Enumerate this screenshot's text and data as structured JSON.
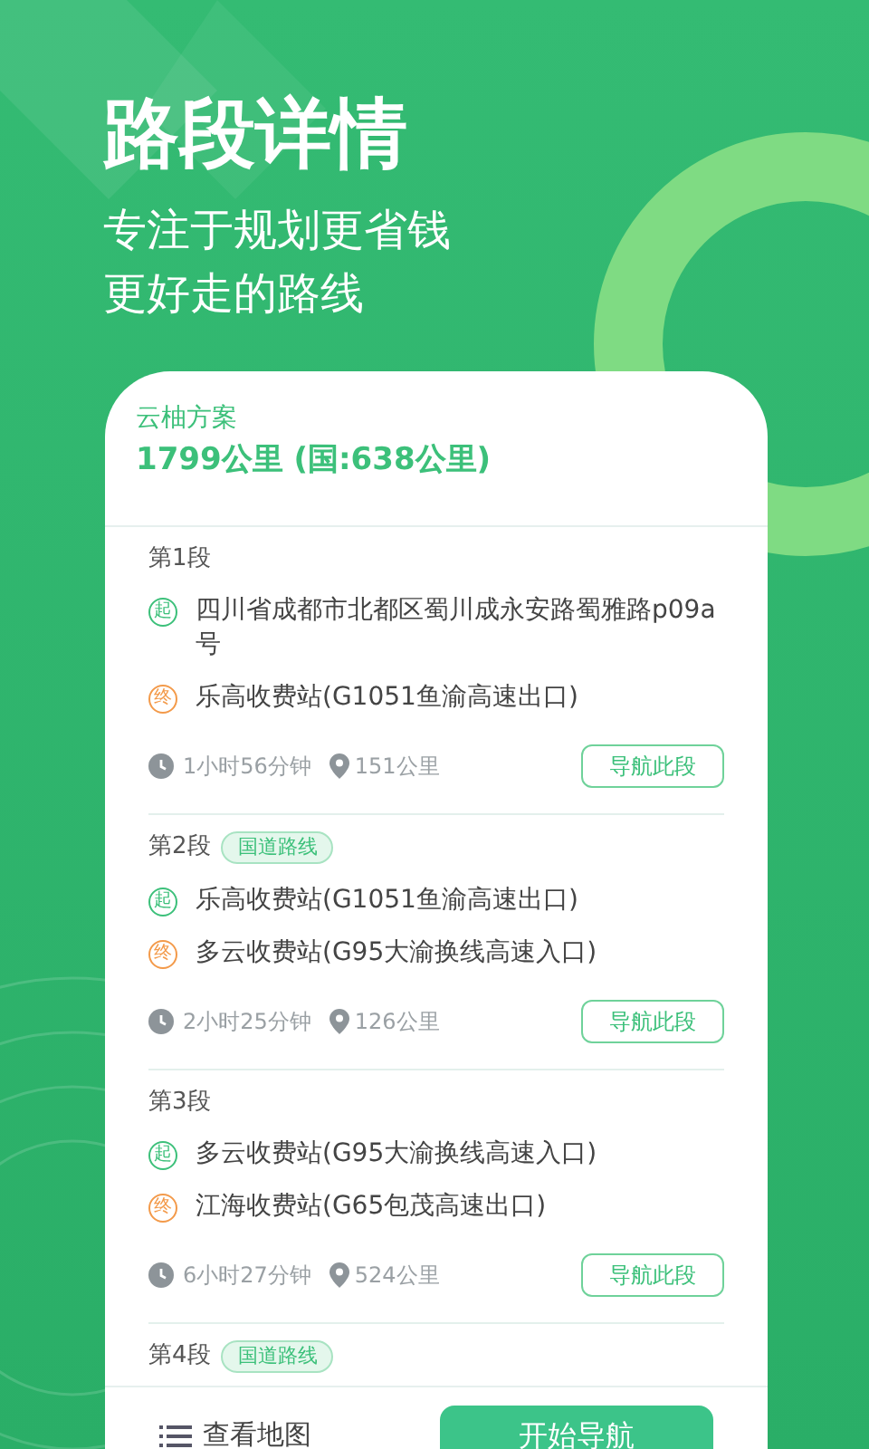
{
  "hero": {
    "title": "路段详情",
    "subtitle_lines": [
      "专注于规划更省钱",
      "更好走的路线"
    ]
  },
  "plan": {
    "name": "云柚方案",
    "summary": "1799公里 (国:638公里)"
  },
  "segments": [
    {
      "label": "第1段",
      "points": [
        {
          "kind": "start",
          "marker": "起",
          "text": "四川省成都市北都区蜀川成永安路蜀雅路p09a号"
        },
        {
          "kind": "end",
          "marker": "终",
          "text": "乐高收费站(G1051鱼渝高速出口)"
        }
      ],
      "duration": "1小时56分钟",
      "distance": "151公里",
      "button": "导航此段"
    },
    {
      "label": "第2段",
      "tag": "国道路线",
      "points": [
        {
          "kind": "start",
          "marker": "起",
          "text": "乐高收费站(G1051鱼渝高速出口)"
        },
        {
          "kind": "end",
          "marker": "终",
          "text": "多云收费站(G95大渝换线高速入口)"
        }
      ],
      "duration": "2小时25分钟",
      "distance": "126公里",
      "button": "导航此段"
    },
    {
      "label": "第3段",
      "points": [
        {
          "kind": "start",
          "marker": "起",
          "text": "多云收费站(G95大渝换线高速入口)"
        },
        {
          "kind": "end",
          "marker": "终",
          "text": "江海收费站(G65包茂高速出口)"
        }
      ],
      "duration": "6小时27分钟",
      "distance": "524公里",
      "button": "导航此段"
    },
    {
      "label": "第4段",
      "tag": "国道路线"
    }
  ],
  "footer": {
    "map_link": "查看地图",
    "start_button": "开始导航"
  }
}
